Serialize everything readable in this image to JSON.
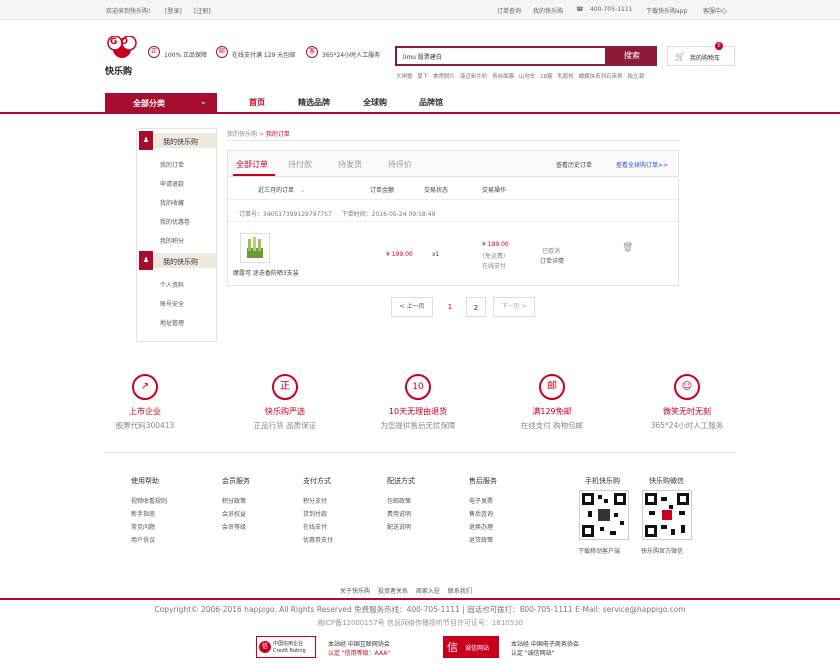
{
  "topbar": {
    "welcome": "欢迎来到快乐购!",
    "login": "[登录]",
    "register": "[注册]",
    "order_query": "订单查询",
    "my_happigo": "我的快乐购",
    "phone": "400-705-1111",
    "download_app": "下载快乐购app",
    "service_center": "客服中心"
  },
  "brand": {
    "logo_mark": "GO",
    "logo_text": "快乐购"
  },
  "guarantees": [
    {
      "icon_text": "正",
      "label": "100% 正品保障"
    },
    {
      "icon_text": "邮",
      "label": "在线支付满 129 元包邮"
    },
    {
      "icon_text": "客",
      "label": "365*24小时人工服务"
    }
  ],
  "search": {
    "value": "limu 股票建白",
    "button": "搜索",
    "hotwords": [
      "大闸蟹",
      "夏下",
      "美莲脱片",
      "港迈新牛奶",
      "青丝面膜",
      "山地车",
      "18霸",
      "乳胶枕",
      "蝴蝶侠系列石英表",
      "独立潮"
    ]
  },
  "cart": {
    "label": "我的购物车",
    "count": "0"
  },
  "nav": {
    "all_categories": "全部分类",
    "items": [
      "首页",
      "精选品牌",
      "全球购",
      "品牌馆"
    ]
  },
  "sidebar": {
    "section1": "我的快乐购",
    "links1": [
      "我的订单",
      "申请退款",
      "我的收藏",
      "我的优惠卷",
      "我的积分"
    ],
    "section2": "我的快乐购",
    "links2": [
      "个人资料",
      "账号安全",
      "地址管理"
    ]
  },
  "breadcrumb": {
    "root": "我的快乐购",
    "sep": ">",
    "current": "我的订单"
  },
  "orders": {
    "tabs": [
      "全部订单",
      "待付款",
      "待发货",
      "待评价"
    ],
    "history_link": "查看历史订单",
    "global_link": "查看全球购订单>>",
    "filter": "近三月的订单",
    "columns": [
      "订单金额",
      "交易状态",
      "交易操作"
    ],
    "order_no_label": "订单号：",
    "order_no": "340517399129797757",
    "order_time_label": "下单时间：",
    "order_time": "2016-05-24 09:58:49",
    "product_name": "摩露可 迷迭香防晒3支装",
    "price": "¥ 199.00",
    "qty": "x1",
    "total": "¥ 199.00",
    "shipping": "（免运费）",
    "pay_method": "在线支付",
    "status": "已取消",
    "detail": "订单详情"
  },
  "pagination": {
    "prev": "< 上一页",
    "pages": [
      "1",
      "2"
    ],
    "next": "下一页 >"
  },
  "features": [
    {
      "icon": "chart-icon",
      "glyph": "↗",
      "title": "上市企业",
      "sub": "股票代码300413"
    },
    {
      "icon": "genuine-icon",
      "glyph": "正",
      "title": "快乐购严选",
      "sub": "正品行货 品质保证"
    },
    {
      "icon": "return-icon",
      "glyph": "10",
      "title": "10天无理由退货",
      "sub": "为您提供售后无忧保障"
    },
    {
      "icon": "mail-icon",
      "glyph": "邮",
      "title": "满129免邮",
      "sub": "在线支付 购物包邮"
    },
    {
      "icon": "service-icon",
      "glyph": "☺",
      "title": "微笑无时无刻",
      "sub": "365*24小时人工服务"
    }
  ],
  "footer_cols": [
    {
      "title": "使用帮助",
      "links": [
        "视频收看规则",
        "新手指南",
        "常见问题",
        "用户协议"
      ]
    },
    {
      "title": "会员服务",
      "links": [
        "积分政策",
        "会员权益",
        "会员等级"
      ]
    },
    {
      "title": "支付方式",
      "links": [
        "积分支付",
        "货到付款",
        "在线支付",
        "优惠劵支付"
      ]
    },
    {
      "title": "配送方式",
      "links": [
        "包邮政策",
        "费用说明",
        "配送说明"
      ]
    },
    {
      "title": "售后服务",
      "links": [
        "电子发票",
        "售后咨询",
        "退换办理",
        "退货政策"
      ]
    }
  ],
  "qr": [
    {
      "title": "手机快乐购",
      "caption": "下载移动客户端"
    },
    {
      "title": "快乐购微信",
      "caption": "快乐购官方微信"
    }
  ],
  "bottom_links": [
    "关于快乐购",
    "投资者关系",
    "商家入驻",
    "联系我们"
  ],
  "copyright": "Copyright© 2006-2016 happigo. All Rights Reserved 免费服务热线：400-705-1111 | 固话也可拨打：800-705-1111 E-Mail: service@happigo.com",
  "icp": "湘ICP备12000157号 信息网络传播视听节目许可证号：1810530",
  "certs": [
    {
      "logo": "信",
      "line1": "中国信用企业",
      "line2": "Credit Rating",
      "text1": "本站经 中国互联网协会",
      "text2": "认定 \"信用等级：AAA\""
    },
    {
      "logo": "信",
      "line1": "诚信网站",
      "line2": "",
      "text1": "本站经 中国电子商务协会",
      "text2": "认定 \"诚信网站\""
    }
  ],
  "colors": {
    "accent": "#a50c2e",
    "red": "#c8001e"
  }
}
